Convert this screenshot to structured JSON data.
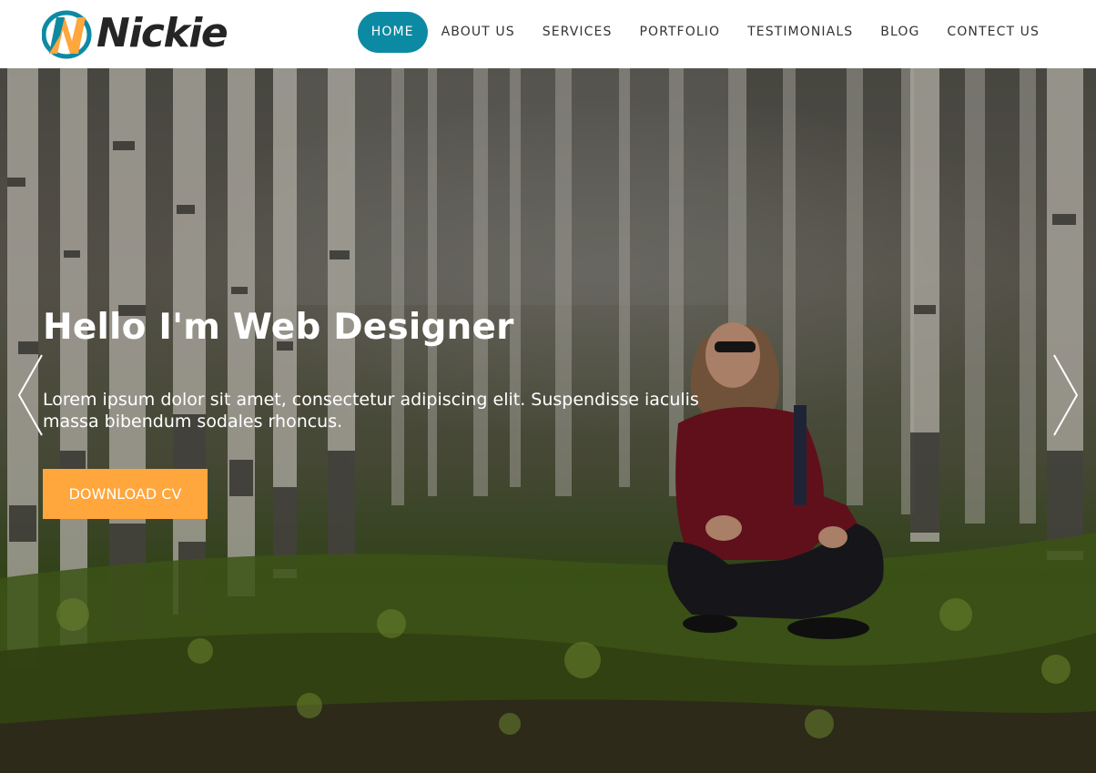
{
  "brand": {
    "logo_letter": "N",
    "name": "Nickie",
    "colors": {
      "teal": "#0d8aa3",
      "orange": "#ffa63d",
      "dark": "#252525"
    }
  },
  "nav": {
    "items": [
      {
        "label": "HOME",
        "active": true
      },
      {
        "label": "ABOUT US",
        "active": false
      },
      {
        "label": "SERVICES",
        "active": false
      },
      {
        "label": "PORTFOLIO",
        "active": false
      },
      {
        "label": "TESTIMONIALS",
        "active": false
      },
      {
        "label": "BLOG",
        "active": false
      },
      {
        "label": "CONTECT US",
        "active": false
      }
    ]
  },
  "hero": {
    "title": "Hello I'm Web Designer",
    "text": "Lorem ipsum dolor sit amet, consectetur adipiscing elit. Suspendisse iaculis massa bibendum sodales rhoncus.",
    "cta_label": "DOWNLOAD CV",
    "prev_icon": "chevron-left-icon",
    "next_icon": "chevron-right-icon"
  }
}
